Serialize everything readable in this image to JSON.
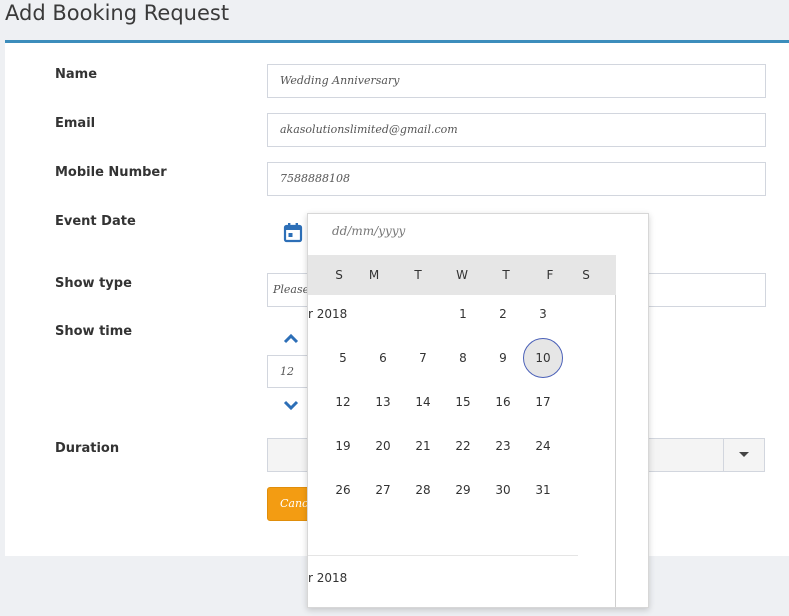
{
  "page": {
    "title": "Add Booking Request"
  },
  "form": {
    "name_label": "Name",
    "name_value": "Wedding Anniversary",
    "email_label": "Email",
    "email_value": "akasolutionslimited@gmail.com",
    "mobile_label": "Mobile Number",
    "mobile_value": "7588888108",
    "event_date_label": "Event Date",
    "show_type_label": "Show type",
    "show_type_value": "Please",
    "show_time_label": "Show time",
    "show_time_hour": "12",
    "duration_label": "Duration",
    "cancel_label": "Cance"
  },
  "datepicker": {
    "placeholder": "dd/mm/yyyy",
    "weekdays": [
      "S",
      "M",
      "T",
      "W",
      "T",
      "F",
      "S"
    ],
    "month_label": "r 2018",
    "next_month_label": "r 2018",
    "weeks": [
      [
        "",
        "",
        "",
        "1",
        "2",
        "3"
      ],
      [
        "5",
        "6",
        "7",
        "8",
        "9",
        "10"
      ],
      [
        "12",
        "13",
        "14",
        "15",
        "16",
        "17"
      ],
      [
        "19",
        "20",
        "21",
        "22",
        "23",
        "24"
      ],
      [
        "26",
        "27",
        "28",
        "29",
        "30",
        "31"
      ]
    ],
    "selected_day": "10"
  },
  "colors": {
    "accent": "#3c8dbc",
    "cancel": "#f39c12",
    "icon_blue": "#2d6fb7"
  }
}
